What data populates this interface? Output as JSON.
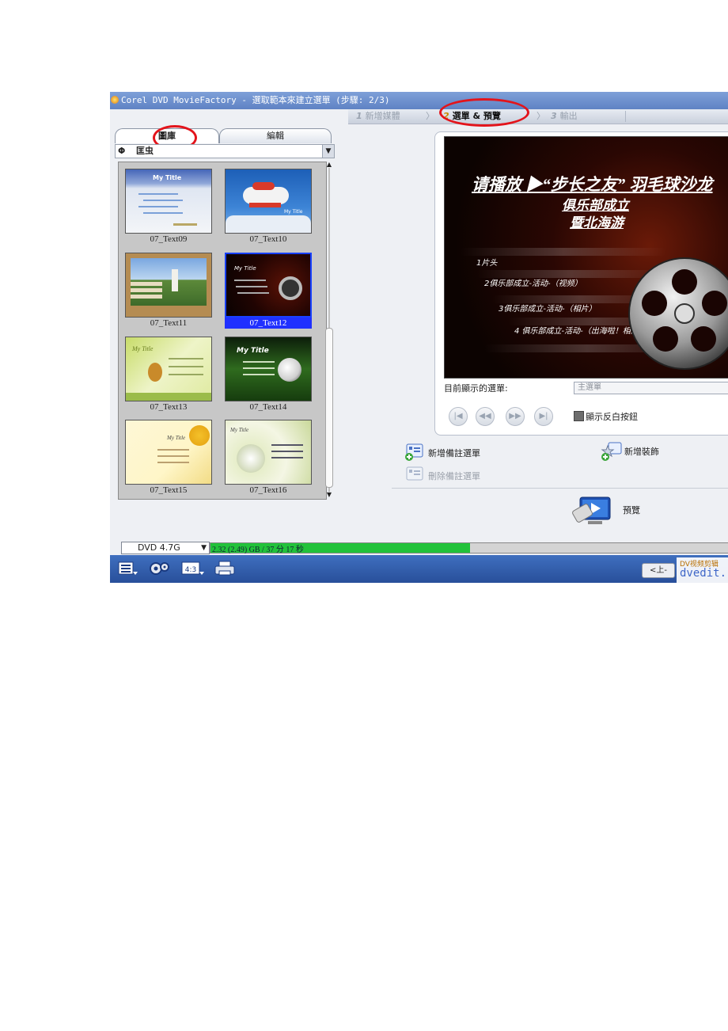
{
  "window": {
    "title": "Corel DVD MovieFactory - 選取範本來建立選單 (步驟: 2/3)"
  },
  "steps": [
    {
      "num": "1",
      "label": "新增媒體",
      "active": false
    },
    {
      "num": "2",
      "label": "選單 & 預覽",
      "active": true
    },
    {
      "num": "3",
      "label": "輸出",
      "active": false
    }
  ],
  "left_panel": {
    "tabs": [
      "圖庫",
      "編輯"
    ],
    "active_tab": "圖庫",
    "category": "匡虫"
  },
  "templates": [
    {
      "name": "07_Text09",
      "selected": false
    },
    {
      "name": "07_Text10",
      "selected": false
    },
    {
      "name": "07_Text11",
      "selected": false
    },
    {
      "name": "07_Text12",
      "selected": true
    },
    {
      "name": "07_Text13",
      "selected": false
    },
    {
      "name": "07_Text14",
      "selected": false
    },
    {
      "name": "07_Text15",
      "selected": false
    },
    {
      "name": "07_Text16",
      "selected": false
    }
  ],
  "thumb_text": {
    "my_title_a": "My Title",
    "my_title_b": "My Title",
    "my_title_c": "My Title",
    "my_title_d": "My Title"
  },
  "preview": {
    "heading_line1": "请播放 ▶“步长之友” 羽毛球沙龙",
    "heading_line2": "俱乐部成立",
    "heading_line3": "暨北海游",
    "items": [
      "1片头",
      "2俱乐部成立-活动-（视频）",
      "3俱乐部成立-活动-（相片）",
      "4 俱乐部成立-活动-（出海啦！相片）"
    ]
  },
  "menu_info": {
    "current_label": "目前顯示的選單:",
    "current_value": "主選單",
    "nav_buttons": [
      "|◀",
      "◀◀",
      "▶▶",
      "▶|"
    ],
    "checkbox_label": "顯示反白按鈕"
  },
  "actions": {
    "add_submenu": "新增備註選單",
    "delete_submenu": "刪除備註選單",
    "add_decoration": "新增裝飾",
    "preview": "預覽"
  },
  "status": {
    "disc_type": "DVD 4.7G",
    "capacity_text": "2.32 (2.49) GB / 37 分 17 秒",
    "capacity_fraction": 0.5
  },
  "bottom": {
    "prev_button": "<上-",
    "watermark_line1": "DV视频剪辑",
    "watermark_line2": "dvedit."
  },
  "colors": {
    "selection": "#2030ff",
    "highlight_oval": "#e3141b",
    "capacity_fill": "#22c23a",
    "titlebar": "#6a8dcd"
  }
}
